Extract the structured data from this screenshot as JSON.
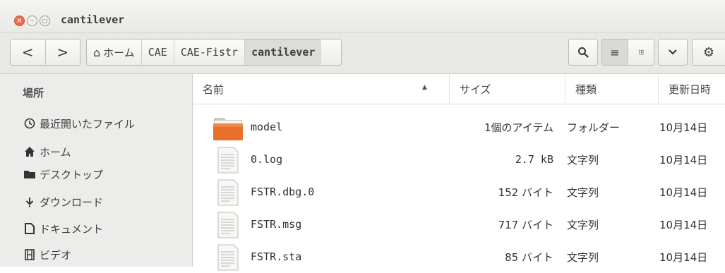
{
  "window": {
    "title": "cantilever"
  },
  "toolbar": {
    "back_icon": "back-arrow-icon",
    "forward_icon": "forward-arrow-icon",
    "breadcrumbs": [
      {
        "label": "ホーム",
        "icon": "home-icon"
      },
      {
        "label": "CAE"
      },
      {
        "label": "CAE-Fistr"
      },
      {
        "label": "cantilever"
      }
    ]
  },
  "sidebar": {
    "heading": "場所",
    "items": [
      {
        "label": "最近開いたファイル",
        "icon": "clock-icon"
      },
      {
        "label": "ホーム",
        "icon": "home-icon"
      },
      {
        "label": "デスクトップ",
        "icon": "desktop-folder-icon"
      },
      {
        "label": "ダウンロード",
        "icon": "download-icon"
      },
      {
        "label": "ドキュメント",
        "icon": "document-icon"
      },
      {
        "label": "ビデオ",
        "icon": "video-icon"
      }
    ]
  },
  "file_list": {
    "columns": [
      "名前",
      "サイズ",
      "種類",
      "更新日時"
    ],
    "sort_column": "名前",
    "sort_direction": "ascending",
    "rows": [
      {
        "name": "model",
        "size": "1個のアイテム",
        "kind": "フォルダー",
        "modified": "10月14日",
        "icon": "folder-icon"
      },
      {
        "name": "0.log",
        "size": "2.7 kB",
        "kind": "文字列",
        "modified": "10月14日",
        "icon": "text-file-icon"
      },
      {
        "name": "FSTR.dbg.0",
        "size": "152 バイト",
        "kind": "文字列",
        "modified": "10月14日",
        "icon": "text-file-icon"
      },
      {
        "name": "FSTR.msg",
        "size": "717 バイト",
        "kind": "文字列",
        "modified": "10月14日",
        "icon": "text-file-icon"
      },
      {
        "name": "FSTR.sta",
        "size": "85 バイト",
        "kind": "文字列",
        "modified": "10月14日",
        "icon": "text-file-icon"
      }
    ]
  },
  "colors": {
    "close_button": "#f16a4a",
    "folder": "#e8702a",
    "toolbar_bg": "#e8e8e5",
    "sidebar_bg": "#ececea"
  }
}
